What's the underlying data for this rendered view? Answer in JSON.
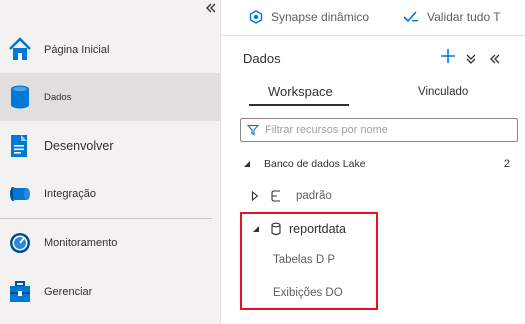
{
  "nav": {
    "items": [
      {
        "label": "Página Inicial",
        "icon": "home-icon"
      },
      {
        "label": "Dados",
        "icon": "database-icon"
      },
      {
        "label": "Desenvolver",
        "icon": "document-icon"
      },
      {
        "label": "Integração",
        "icon": "pipeline-icon"
      },
      {
        "label": "Monitoramento",
        "icon": "gauge-icon"
      },
      {
        "label": "Gerenciar",
        "icon": "toolbox-icon"
      }
    ],
    "collapse_icon": "double-chevron-left-icon",
    "selected": "Dados"
  },
  "toolbar": {
    "synapse_label": "Synapse dinâmico",
    "validate_label": "Validar tudo T"
  },
  "panel": {
    "title": "Dados",
    "tabs": [
      {
        "label": "Workspace",
        "active": true
      },
      {
        "label": "Vinculado",
        "active": false
      }
    ],
    "search": {
      "placeholder": "Filtrar recursos por nome",
      "value": ""
    },
    "tree": {
      "group_label": "Banco de dados Lake",
      "group_count": "2",
      "databases": [
        {
          "label": "padrão",
          "expanded": false
        },
        {
          "label": "reportdata",
          "expanded": true
        }
      ],
      "children": [
        {
          "label": "Tabelas D P"
        },
        {
          "label": "Exibições DO"
        }
      ]
    }
  },
  "colors": {
    "accent": "#0078d4",
    "highlight": "#e81123",
    "nav_bg": "#f3f2f1"
  }
}
